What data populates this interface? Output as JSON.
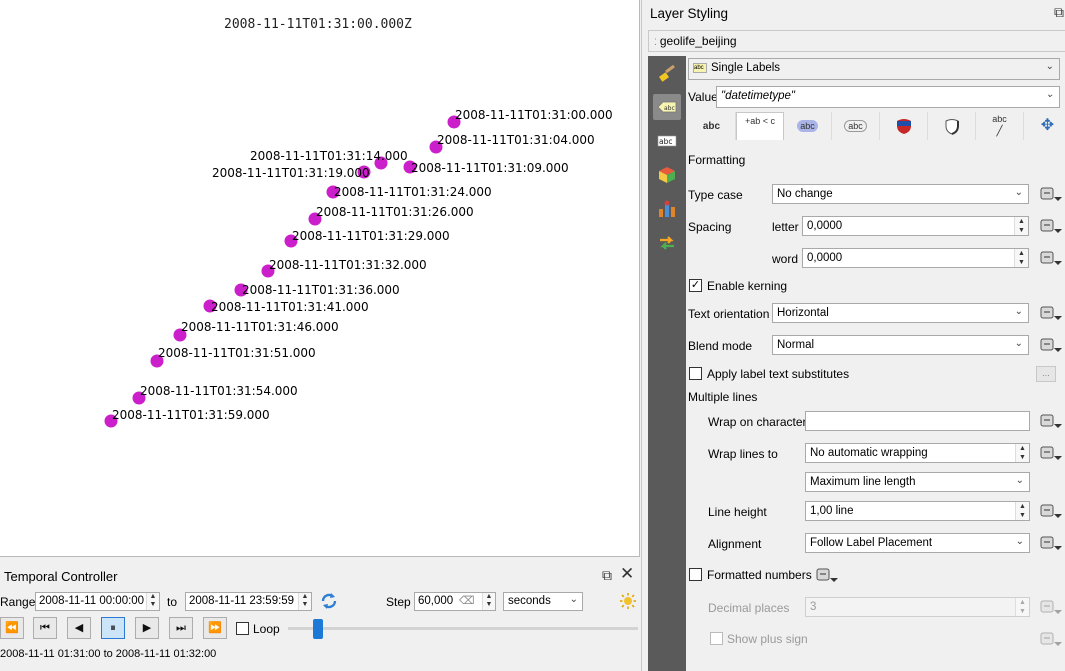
{
  "map": {
    "title": "2008-11-11T01:31:00.000Z",
    "point_color": "#cc1fcc",
    "points": [
      {
        "label": "2008-11-11T01:31:00.000"
      },
      {
        "label": "2008-11-11T01:31:04.000"
      },
      {
        "label": "2008-11-11T01:31:09.000"
      },
      {
        "label": "2008-11-11T01:31:14.000"
      },
      {
        "label": "2008-11-11T01:31:19.000"
      },
      {
        "label": "2008-11-11T01:31:24.000"
      },
      {
        "label": "2008-11-11T01:31:26.000"
      },
      {
        "label": "2008-11-11T01:31:29.000"
      },
      {
        "label": "2008-11-11T01:31:32.000"
      },
      {
        "label": "2008-11-11T01:31:36.000"
      },
      {
        "label": "2008-11-11T01:31:41.000"
      },
      {
        "label": "2008-11-11T01:31:46.000"
      },
      {
        "label": "2008-11-11T01:31:51.000"
      },
      {
        "label": "2008-11-11T01:31:54.000"
      },
      {
        "label": "2008-11-11T01:31:59.000"
      }
    ]
  },
  "temporal_controller": {
    "title": "Temporal Controller",
    "range_label": "Range",
    "range_from": "2008-11-11 00:00:00",
    "to_label": "to",
    "range_to": "2008-11-11 23:59:59",
    "step_label": "Step",
    "step_value": "60,000",
    "step_unit": "seconds",
    "loop_label": "Loop",
    "loop_checked": false,
    "slider_position": 0.07,
    "status": "2008-11-11 01:31:00 to 2008-11-11 01:32:00",
    "buttons": {
      "rewind": "⏪",
      "skip_start": "⏮",
      "back": "◀",
      "pause": "⏸",
      "forward": "▶",
      "skip_end": "⏭",
      "fast_forward": "⏩"
    }
  },
  "layer_styling": {
    "title": "Layer Styling",
    "layer_name": "geolife_beijing",
    "labels_mode": "Single Labels",
    "value_label": "Value",
    "value_expr": "\"datetimetype\"",
    "subtabs": [
      "abc",
      "+ab < c",
      "abc",
      "abc",
      "",
      "",
      "abc",
      ""
    ],
    "formatting_header": "Formatting",
    "type_case_label": "Type case",
    "type_case_value": "No change",
    "spacing_label": "Spacing",
    "letter_label": "letter",
    "letter_value": "0,0000",
    "word_label": "word",
    "word_value": "0,0000",
    "kerning_label": "Enable kerning",
    "kerning_checked": true,
    "text_orientation_label": "Text orientation",
    "text_orientation_value": "Horizontal",
    "blend_mode_label": "Blend mode",
    "blend_mode_value": "Normal",
    "substitutes_label": "Apply label text substitutes",
    "substitutes_btn": "...",
    "multiple_lines_header": "Multiple lines",
    "wrap_char_label": "Wrap on character",
    "wrap_char_value": "",
    "wrap_lines_label": "Wrap lines to",
    "wrap_lines_value": "No automatic wrapping",
    "max_line_value": "Maximum line length",
    "line_height_label": "Line height",
    "line_height_value": "1,00 line",
    "alignment_label": "Alignment",
    "alignment_value": "Follow Label Placement",
    "formatted_numbers_label": "Formatted numbers",
    "decimal_places_label": "Decimal places",
    "decimal_places_value": "3",
    "show_plus_label": "Show plus sign"
  }
}
